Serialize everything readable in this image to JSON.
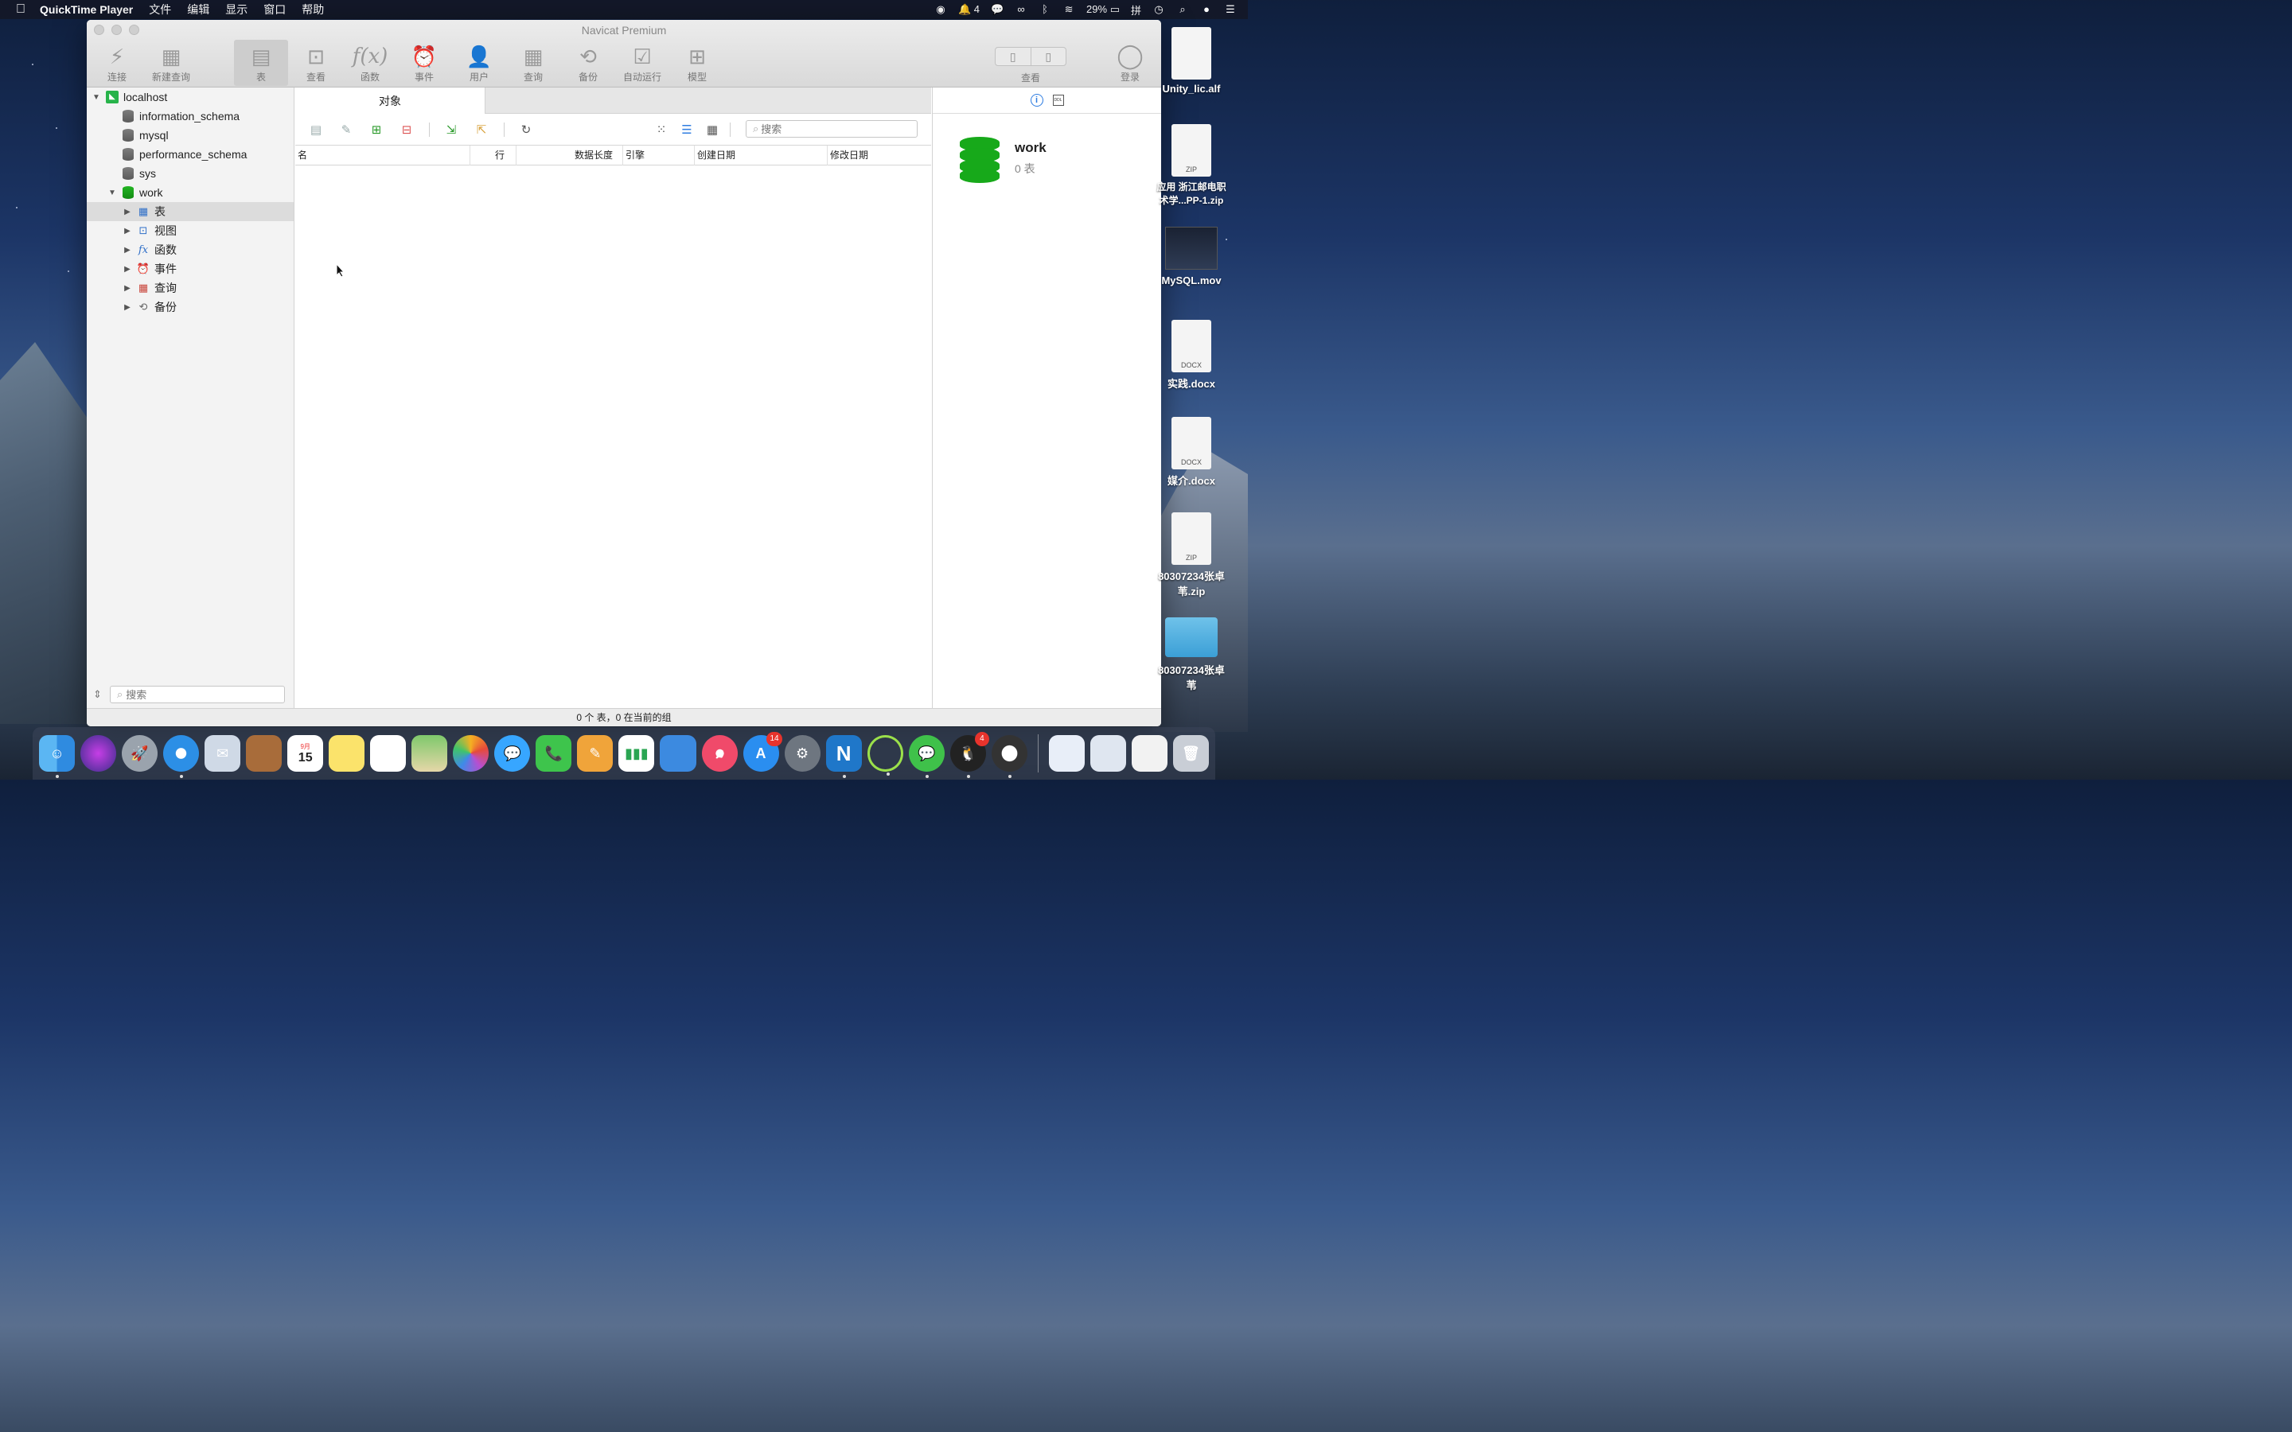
{
  "menubar": {
    "app_name": "QuickTime Player",
    "menus": [
      "文件",
      "编辑",
      "显示",
      "窗口",
      "帮助"
    ],
    "notification_count": "4",
    "battery": "29%",
    "input_method": "拼"
  },
  "window": {
    "title": "Navicat Premium",
    "toolbar": [
      {
        "label": "连接",
        "icon": "connection-icon"
      },
      {
        "label": "新建查询",
        "icon": "new-query-icon"
      },
      {
        "label": "表",
        "icon": "table-icon"
      },
      {
        "label": "查看",
        "icon": "view-icon"
      },
      {
        "label": "函数",
        "icon": "function-icon"
      },
      {
        "label": "事件",
        "icon": "event-icon"
      },
      {
        "label": "用户",
        "icon": "user-icon"
      },
      {
        "label": "查询",
        "icon": "query-icon"
      },
      {
        "label": "备份",
        "icon": "backup-icon"
      },
      {
        "label": "自动运行",
        "icon": "automation-icon"
      },
      {
        "label": "模型",
        "icon": "model-icon"
      }
    ],
    "view_label": "查看",
    "login_label": "登录"
  },
  "sidebar": {
    "host": "localhost",
    "databases": [
      "information_schema",
      "mysql",
      "performance_schema",
      "sys",
      "work"
    ],
    "objects": [
      "表",
      "视图",
      "函数",
      "事件",
      "查询",
      "备份"
    ],
    "search_placeholder": "搜索"
  },
  "main": {
    "tab_label": "对象",
    "search_placeholder": "搜索",
    "columns": [
      "名",
      "行",
      "数据长度",
      "引擎",
      "创建日期",
      "修改日期"
    ]
  },
  "info_panel": {
    "db_name": "work",
    "subtitle": "0 表"
  },
  "statusbar": {
    "text": "0 个 表，0 在当前的组"
  },
  "desktop": [
    {
      "name": "Unity_lic.alf",
      "kind": "file"
    },
    {
      "name": "应用 浙江邮电职\n术学...PP-1.zip",
      "kind": "zip"
    },
    {
      "name": "MySQL.mov",
      "kind": "video"
    },
    {
      "name": "实践.docx",
      "kind": "docx"
    },
    {
      "name": "媒介.docx",
      "kind": "docx"
    },
    {
      "name": "80307234张卓\n苇.zip",
      "kind": "zip"
    },
    {
      "name": "80307234张卓\n苇",
      "kind": "folder"
    }
  ],
  "doc_labels": {
    "zip": "ZIP",
    "docx": "DOCX"
  },
  "dock": {
    "calendar_month": "9月",
    "calendar_day": "15",
    "appstore_badge": "14",
    "qq_badge": "4",
    "navicat_letter": "N"
  }
}
